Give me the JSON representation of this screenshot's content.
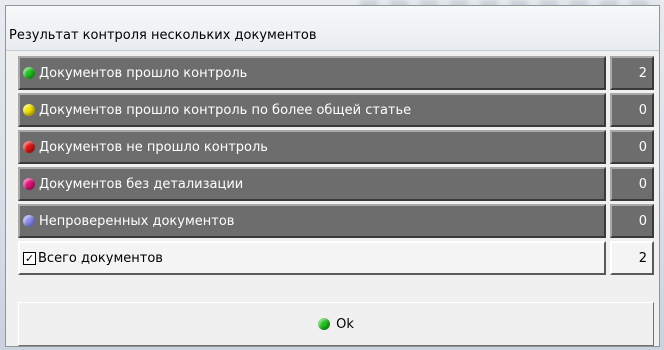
{
  "window": {
    "title": "Результат контроля нескольких документов"
  },
  "colors": {
    "green": "#22c322",
    "yellow": "#f2e600",
    "red": "#e01818",
    "magenta": "#e0157a",
    "lavender": "#8c8cf0",
    "row_bg": "#6d6d6d"
  },
  "rows": [
    {
      "label": "Документов прошло контроль",
      "count": "2",
      "icon": "green-status-dot"
    },
    {
      "label": "Документов прошло контроль по более общей статье",
      "count": "0",
      "icon": "yellow-status-dot"
    },
    {
      "label": "Документов не прошло контроль",
      "count": "0",
      "icon": "red-status-dot"
    },
    {
      "label": "Документов без детализации",
      "count": "0",
      "icon": "magenta-status-dot"
    },
    {
      "label": "Непроверенных документов",
      "count": "0",
      "icon": "lavender-status-dot"
    }
  ],
  "total": {
    "label": "Всего документов",
    "count": "2",
    "checked": true,
    "check_glyph": "✓"
  },
  "ok_button": {
    "label": "Ok",
    "icon": "green-status-dot"
  }
}
